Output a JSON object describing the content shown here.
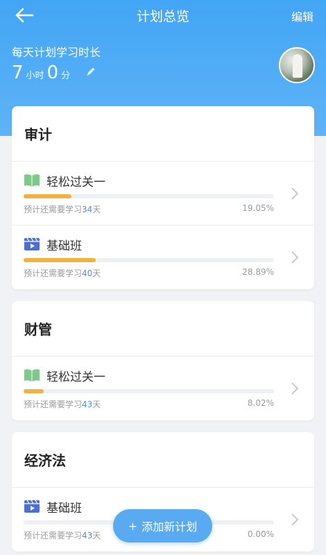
{
  "nav": {
    "title": "计划总览",
    "edit_label": "编辑"
  },
  "summary": {
    "daily_label": "每天计划学习时长",
    "hours": "7",
    "hours_unit": "小时",
    "minutes": "0",
    "minutes_unit": "分"
  },
  "colors": {
    "header": "#42a5f5",
    "progress": "#f2b33d",
    "days_text": "#4a90e2",
    "book_icon": "#7cc98a",
    "video_icon": "#4b6fd6"
  },
  "plans": [
    {
      "subject": "审计",
      "items": [
        {
          "icon": "book-icon",
          "name": "轻松过关一",
          "prefix": "预计还需要学习",
          "days": "34",
          "suffix": "天",
          "percent": "19.05%",
          "progress": 0.1905
        },
        {
          "icon": "video-icon",
          "name": "基础班",
          "prefix": "预计还需要学习",
          "days": "40",
          "suffix": "天",
          "percent": "28.89%",
          "progress": 0.2889
        }
      ]
    },
    {
      "subject": "财管",
      "items": [
        {
          "icon": "book-icon",
          "name": "轻松过关一",
          "prefix": "预计还需要学习",
          "days": "43",
          "suffix": "天",
          "percent": "8.02%",
          "progress": 0.0802
        }
      ]
    },
    {
      "subject": "经济法",
      "items": [
        {
          "icon": "video-icon",
          "name": "基础班",
          "prefix": "预计还需要学习",
          "days": "43",
          "suffix": "天",
          "percent": "0.00%",
          "progress": 0
        }
      ]
    }
  ],
  "add_button": {
    "plus": "+",
    "label": "添加新计划"
  }
}
